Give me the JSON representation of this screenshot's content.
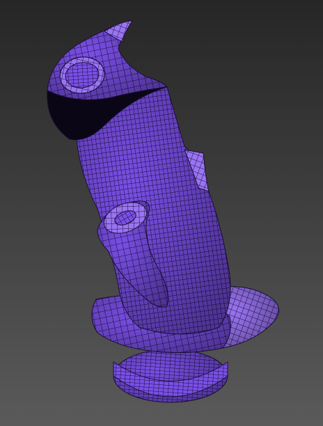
{
  "viewport": {
    "background_top": "#262626",
    "background_bottom": "#5a5a5a",
    "mesh_fill": "#7a4fe6",
    "mesh_fill_light": "#9a74f2",
    "mesh_shadow": "#2a1660",
    "wire_color": "#1a0f3a",
    "object_icon": "joystick-grip-mesh-icon"
  }
}
